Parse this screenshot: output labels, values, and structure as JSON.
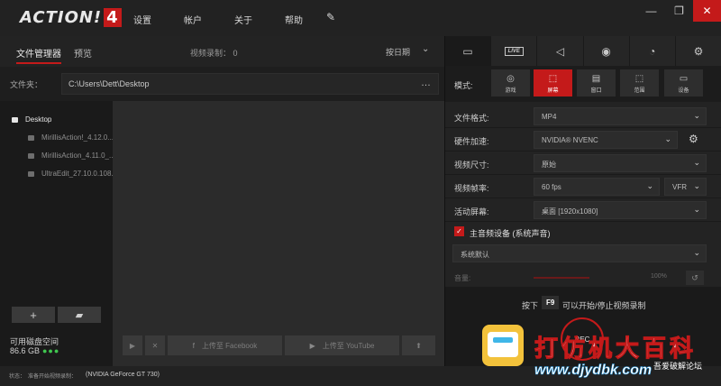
{
  "app": {
    "logo_text": "ACTION!",
    "logo_number": "4",
    "menu": [
      "设置",
      "帐户",
      "关于",
      "帮助"
    ],
    "window_controls": {
      "minimize": "—",
      "restore": "❐",
      "close": "✕"
    }
  },
  "left": {
    "tabs": [
      "文件管理器",
      "预览"
    ],
    "recording_count": "视频录制： 0",
    "sort_label": "按日期",
    "folder_label": "文件夹：",
    "folder_path": "C:\\Users\\Dett\\Desktop",
    "folder_more": "…",
    "tree": {
      "root": "Desktop",
      "children": [
        "MirillisAction!_4.12.0...",
        "MirillisAction_4.11.0_...",
        "UltraEdit_27.10.0.108..."
      ]
    },
    "add_label": "+",
    "disk_label": "可用磁盘空间",
    "disk_value": "86.6 GB",
    "disk_dots": "●●●",
    "actions": {
      "play": "▶",
      "delete": "✕",
      "facebook": "上传至 Facebook",
      "youtube": "上传至 YouTube",
      "upload": "⬆"
    }
  },
  "right": {
    "mode_label": "模式:",
    "modes": [
      "游戏",
      "屏幕",
      "窗口",
      "范围",
      "设备"
    ],
    "active_mode": "屏幕",
    "live_label": "LIVE",
    "settings": {
      "format_label": "文件格式:",
      "format_value": "MP4",
      "hw_label": "硬件加速:",
      "hw_value": "NVIDIA® NVENC",
      "size_label": "视频尺寸:",
      "size_value": "原始",
      "fps_label": "视频帧率:",
      "fps_value": "60 fps",
      "fps_mode": "VFR",
      "screen_label": "活动屏幕:",
      "screen_value": "桌面 [1920x1080]"
    },
    "audio": {
      "title": "主音频设备 (系统声音)",
      "device": "系统默认",
      "volume_label": "音量:",
      "volume_value": "100%"
    },
    "hint": {
      "press": "按下",
      "key": "F9",
      "action": "可以开始/停止视频录制"
    },
    "rec_label": "REC"
  },
  "status": {
    "text": "状态：　准备开始视频录制：",
    "gpu": "(NVIDIA GeForce GT 730)"
  },
  "watermark": {
    "title": "打仿机大百科",
    "sub": "吾爱破解论坛",
    "url": "www.djydbk.com"
  }
}
